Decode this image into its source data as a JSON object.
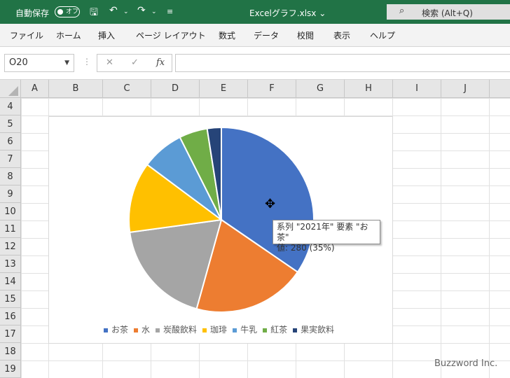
{
  "titlebar": {
    "autosave_label": "自動保存",
    "toggle_state": "オフ",
    "filename": "Excelグラフ.xlsx ⌄",
    "search_text": "検索 (Alt+Q)"
  },
  "ribbon": {
    "tabs": [
      "ファイル",
      "ホーム",
      "挿入",
      "ページ レイアウト",
      "数式",
      "データ",
      "校閲",
      "表示",
      "ヘルプ"
    ]
  },
  "formula_bar": {
    "name_box": "O20",
    "fx": "fx",
    "cancel": "✕",
    "enter": "✓",
    "content": ""
  },
  "grid": {
    "columns": [
      "A",
      "B",
      "C",
      "D",
      "E",
      "F",
      "G",
      "H",
      "I",
      "J"
    ],
    "rows": [
      "4",
      "5",
      "6",
      "7",
      "8",
      "9",
      "10",
      "11",
      "12",
      "13",
      "14",
      "15",
      "16",
      "17",
      "18",
      "19"
    ]
  },
  "chart_data": {
    "type": "pie",
    "categories": [
      "お茶",
      "水",
      "炭酸飲料",
      "珈琲",
      "牛乳",
      "紅茶",
      "果実飲料"
    ],
    "values": [
      280,
      160,
      150,
      100,
      60,
      40,
      20
    ],
    "colors": [
      "#4472C4",
      "#ED7D31",
      "#A5A5A5",
      "#FFC000",
      "#5B9BD5",
      "#70AD47",
      "#264478"
    ],
    "legend_position": "bottom"
  },
  "tooltip": {
    "line1": "系列 \"2021年\" 要素 \"お茶\"",
    "line2": "値: 280 (35%)"
  },
  "watermark": "Buzzword Inc."
}
